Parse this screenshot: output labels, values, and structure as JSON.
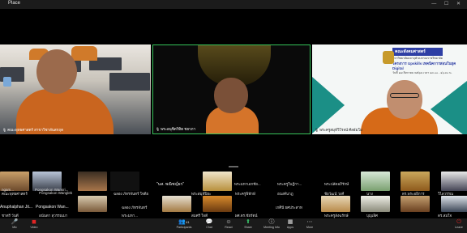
{
  "window": {
    "title": "Place"
  },
  "main_tiles": [
    {
      "name": "คณะพุทธศาสตร์ สาขาวิชาสันสกฤต"
    },
    {
      "name": "พระอนุชิตวิทิต ชยาภา"
    },
    {
      "name": "พระครูสมุห์วิโรจน์ ศีลธัมโม"
    }
  ],
  "banner": {
    "title": "คณะสังคมศาสตร์",
    "subtitle": "มหาวิทยาลัยมหาจุฬาลงกรณราชวิทยาลัย",
    "project": "โครงการ Upskills เทคนิคการสอนในยุค Digital",
    "date": "วันที่ ๑๗ สิงหาคม ๒๕๖๗    เวลา ๑๓.๐๐ - ๑๖.๓๐ น."
  },
  "gallery": {
    "row1_labels": [
      "ngam...",
      "Pongsakon Wansri...",
      "ฉลอง ภัทรจันทร์",
      "พระมหาบุญเรือน...",
      "มาลัยวัดศรี...",
      "พระครูวิจิตร..."
    ],
    "row2_labels": [
      "วิวัฒน์",
      "Anuphalphan Jit...",
      "Pongsakon Wan...",
      "\"นส. พณิชญ์ธร\"",
      "พระมหาเอกชัย...",
      "พระครูใบฎีกา...",
      "เกศินี ยศประสาท",
      "พระปลัดอภิรักษ์"
    ],
    "row3_labels": [
      "คณะพุทธศาสตร์",
      "Pongsakon Wanglek",
      "ฉลอง ภัทรจันทร์ ใจดีย",
      "พระสมุห์ปิยะ",
      "พระครูพิทักษ์",
      "อนงค์นาฎ",
      "ชัยวัฒน์ วงศ์",
      "นาง",
      "ดร.พระอธิการ",
      "วิไลวรรณ"
    ],
    "row4_labels": [
      "ชาตรี วันดี",
      "อนันตา สุวรรณมา",
      "พระมหา...",
      "สมศรี ใจดี",
      "ผศ.ดร.ชัยรัตน์",
      "ภิกษุณี",
      "พระครูสังฆรักษ์",
      "บุญเลิศ",
      "ดร.สมใจ"
    ]
  },
  "toolbar": {
    "items": [
      {
        "label": "Mic",
        "icon": "mic-muted-icon"
      },
      {
        "label": "Video",
        "icon": "video-off-icon"
      },
      {
        "label": "Participants",
        "icon": "participants-icon",
        "count": "41"
      },
      {
        "label": "Chat",
        "icon": "chat-icon"
      },
      {
        "label": "React",
        "icon": "react-icon"
      },
      {
        "label": "Share",
        "icon": "share-icon"
      },
      {
        "label": "Meeting Info",
        "icon": "info-icon"
      },
      {
        "label": "Apps",
        "icon": "apps-icon"
      },
      {
        "label": "More",
        "icon": "more-icon"
      },
      {
        "label": "Leave",
        "icon": "leave-icon"
      }
    ]
  },
  "colors": {
    "active_speaker": "#36c45a",
    "toolbar_bg": "#1a1a1a",
    "leave": "#e02424"
  }
}
